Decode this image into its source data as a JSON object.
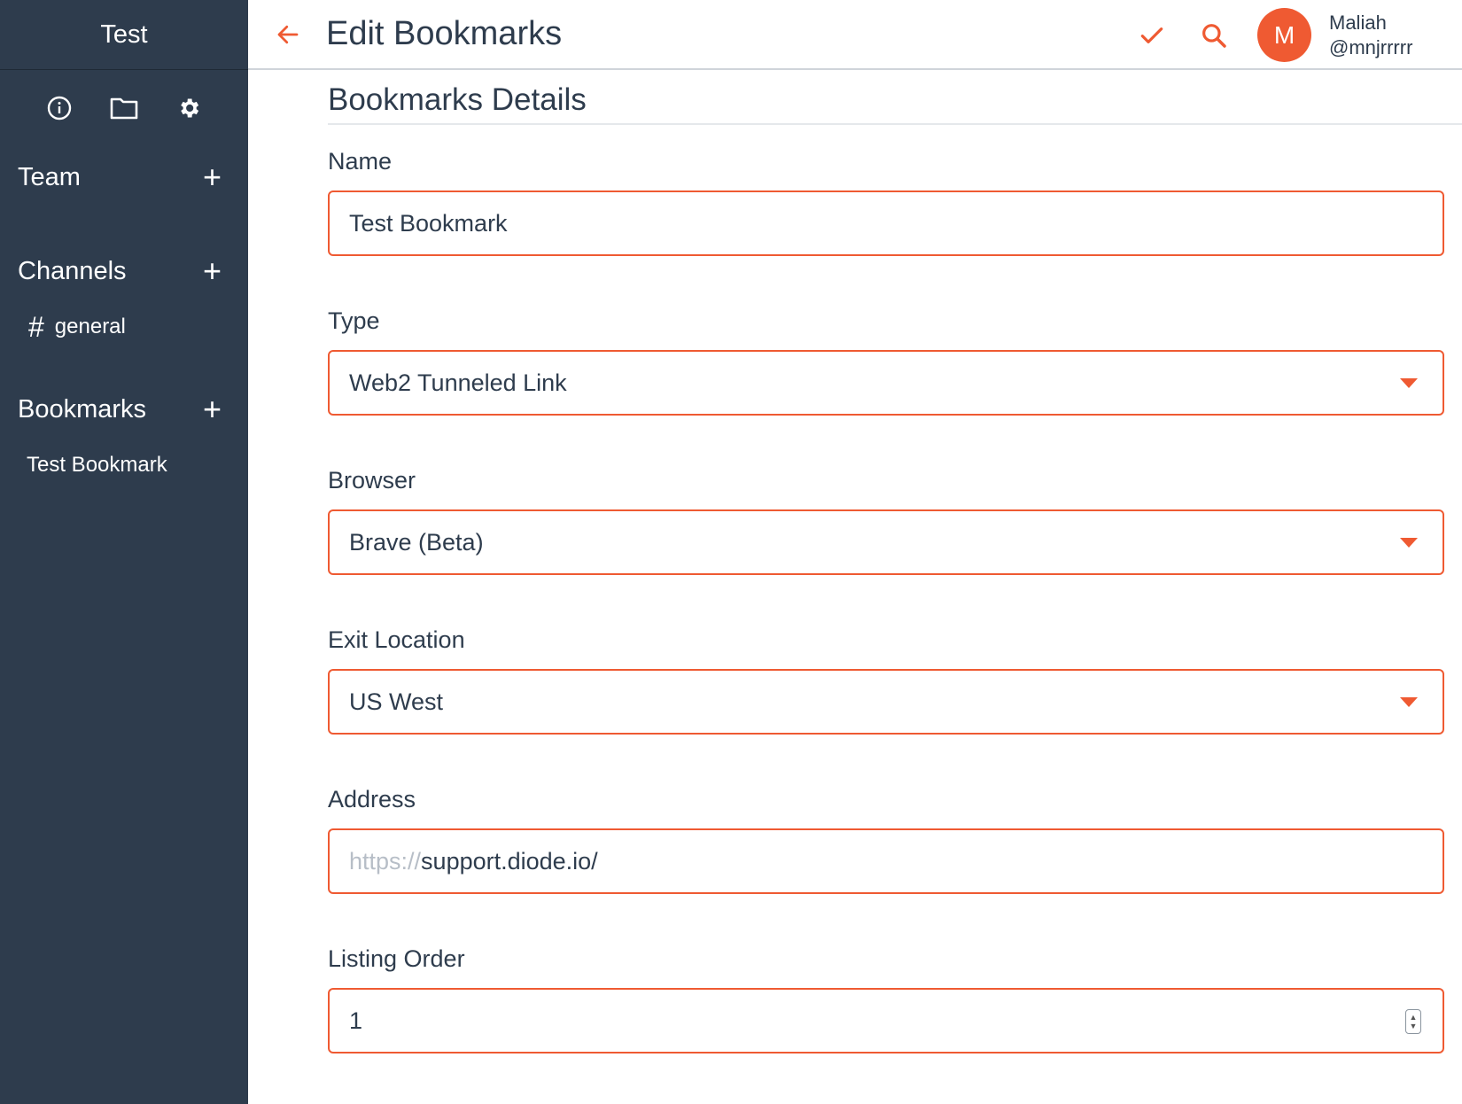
{
  "sidebar": {
    "workspace_title": "Test",
    "sections": {
      "team": {
        "label": "Team",
        "add": "+"
      },
      "channels": {
        "label": "Channels",
        "add": "+",
        "items": [
          {
            "hash": "#",
            "label": "general"
          }
        ]
      },
      "bookmarks": {
        "label": "Bookmarks",
        "add": "+",
        "items": [
          {
            "label": "Test Bookmark"
          }
        ]
      }
    },
    "icons": [
      "info-icon",
      "folder-icon",
      "gear-icon"
    ]
  },
  "header": {
    "title": "Edit Bookmarks",
    "user": {
      "initial": "M",
      "name": "Maliah",
      "handle": "@mnjrrrrr"
    },
    "icons": [
      "back-arrow-icon",
      "check-icon",
      "search-icon"
    ]
  },
  "form": {
    "section_title": "Bookmarks Details",
    "name": {
      "label": "Name",
      "value": "Test Bookmark"
    },
    "type": {
      "label": "Type",
      "value": "Web2 Tunneled Link"
    },
    "browser": {
      "label": "Browser",
      "value": "Brave (Beta)"
    },
    "exit_location": {
      "label": "Exit Location",
      "value": "US West"
    },
    "address": {
      "label": "Address",
      "prefix": "https://",
      "value": "support.diode.io/"
    },
    "listing_order": {
      "label": "Listing Order",
      "value": "1"
    }
  },
  "colors": {
    "sidebar_bg": "#2e3c4d",
    "accent": "#ef5a32",
    "text": "#2e3c4d"
  }
}
